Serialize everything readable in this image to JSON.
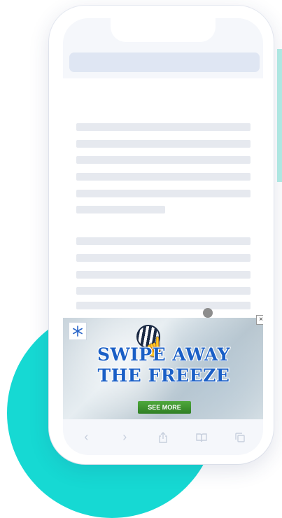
{
  "ad": {
    "headline_line1": "SWIPE AWAY",
    "headline_line2": "THE FREEZE",
    "cta_label": "SEE MORE",
    "close_glyph": "×",
    "logo_icon": "snowflake-icon",
    "colors": {
      "headline": "#1a5fc6",
      "cta": "#3c9431"
    }
  },
  "toolbar": {
    "back_glyph": "‹",
    "forward_glyph": "›",
    "icons": [
      "chevron-left-icon",
      "chevron-right-icon",
      "share-icon",
      "book-icon",
      "tabs-icon"
    ]
  },
  "colors": {
    "accent": "#16d9d3",
    "skeleton": "#e6e9ef",
    "address_bar": "#dfe6f3"
  }
}
